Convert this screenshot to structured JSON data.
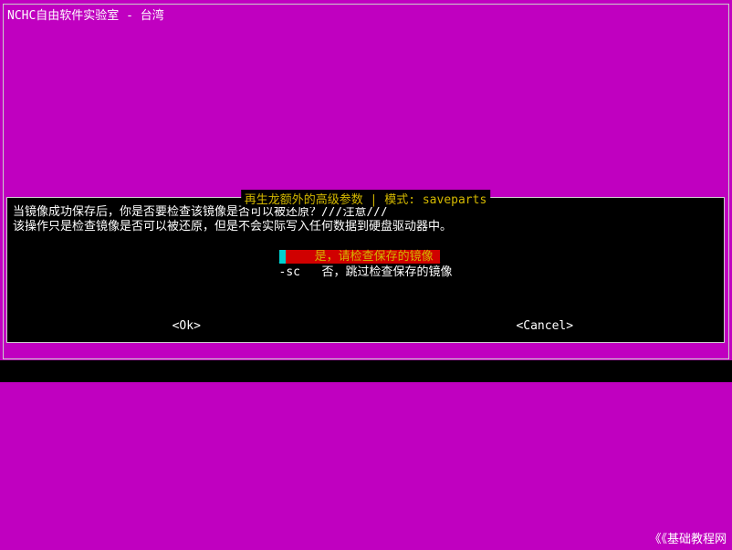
{
  "window": {
    "title": "NCHC自由软件实验室 - 台湾"
  },
  "dialog": {
    "title": "再生龙额外的高级参数 | 模式: saveparts",
    "body_line1": "当镜像成功保存后，你是否要检查该镜像是否可以被还原？///注意///",
    "body_line2": "该操作只是检查镜像是否可以被还原，但是不会实际写入任何数据到硬盘驱动器中。",
    "options": {
      "selected": {
        "text": "是，请检查保存的镜像"
      },
      "unselected": {
        "flag": "-sc",
        "text": "否，跳过检查保存的镜像"
      }
    },
    "buttons": {
      "ok": "<Ok>",
      "cancel": "<Cancel>"
    }
  },
  "footer": {
    "text": "《《基础教程网"
  }
}
